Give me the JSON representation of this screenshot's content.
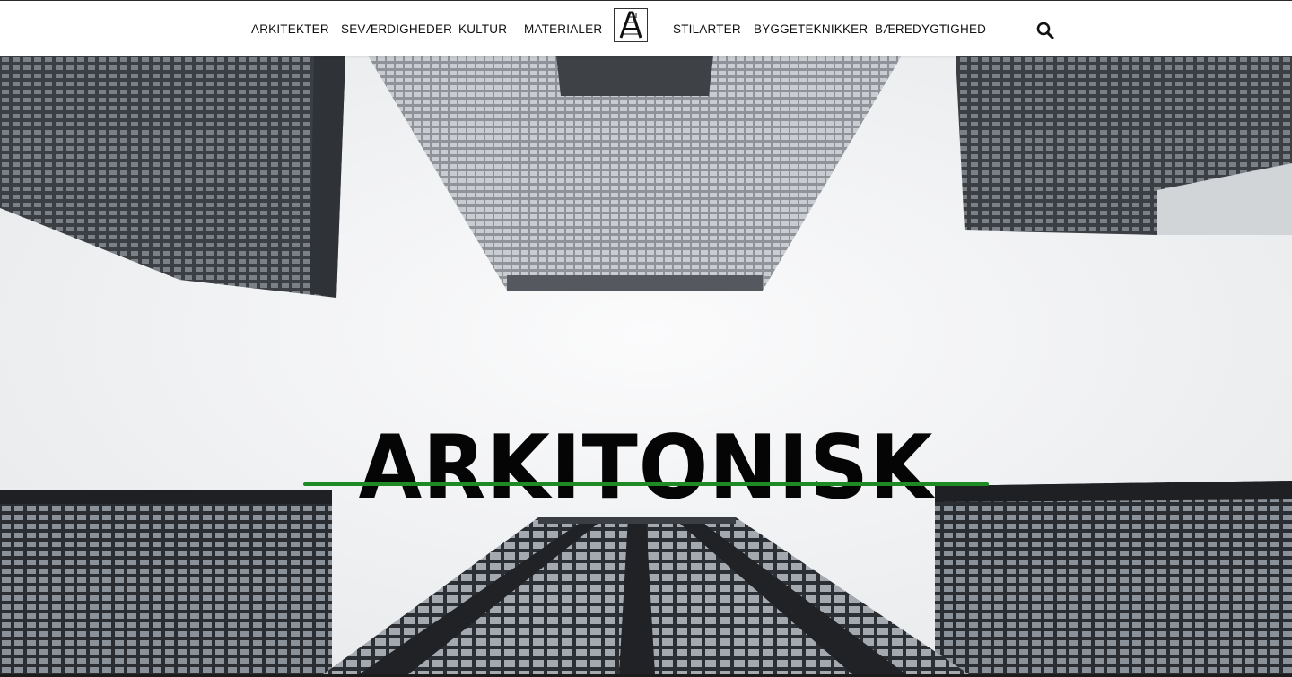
{
  "nav": {
    "items_left": [
      "ARKITEKTER",
      "SEVÆRDIGHEDER",
      "KULTUR",
      "MATERIALER"
    ],
    "items_right": [
      "STILARTER",
      "BYGGETEKNIKKER",
      "BÆREDYGTIGHED"
    ],
    "logo_icon": "letter-a-logo-icon",
    "search_icon": "search-icon"
  },
  "hero": {
    "title": "ARKITONISK",
    "background": "skyscrapers-looking-up-photo"
  },
  "colors": {
    "accent_underline": "#1e8a24",
    "text": "#050505",
    "header_bg": "#ffffff"
  }
}
